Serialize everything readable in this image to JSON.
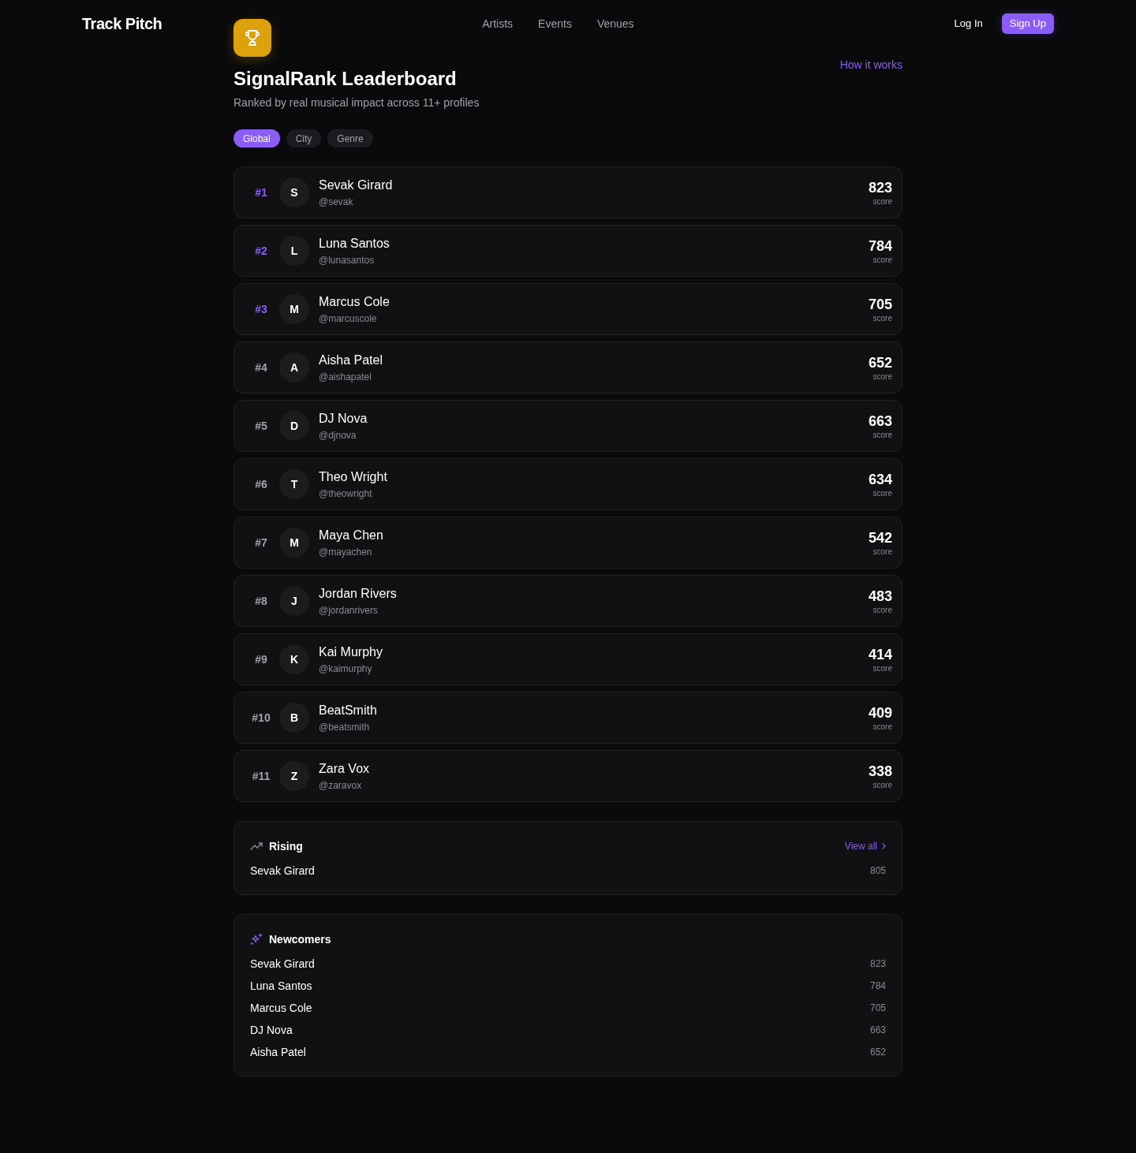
{
  "header": {
    "logo": "Track Pitch",
    "nav": [
      {
        "label": "Artists"
      },
      {
        "label": "Events"
      },
      {
        "label": "Venues"
      }
    ],
    "login": "Log In",
    "signup": "Sign Up"
  },
  "page": {
    "title": "SignalRank Leaderboard",
    "subtitle": "Ranked by real musical impact across 11+ profiles",
    "help_link": "How it works"
  },
  "tabs": [
    {
      "label": "Global",
      "selected": true
    },
    {
      "label": "City",
      "selected": false
    },
    {
      "label": "Genre",
      "selected": false
    }
  ],
  "leaderboard": [
    {
      "rank": "#1",
      "highlighted": true,
      "initial": "S",
      "name": "Sevak Girard",
      "handle": "@sevak",
      "score": "823",
      "score_label": "score"
    },
    {
      "rank": "#2",
      "highlighted": true,
      "initial": "L",
      "name": "Luna Santos",
      "handle": "@lunasantos",
      "score": "784",
      "score_label": "score"
    },
    {
      "rank": "#3",
      "highlighted": true,
      "initial": "M",
      "name": "Marcus Cole",
      "handle": "@marcuscole",
      "score": "705",
      "score_label": "score"
    },
    {
      "rank": "#4",
      "highlighted": false,
      "initial": "A",
      "name": "Aisha Patel",
      "handle": "@aishapatel",
      "score": "652",
      "score_label": "score"
    },
    {
      "rank": "#5",
      "highlighted": false,
      "initial": "D",
      "name": "DJ Nova",
      "handle": "@djnova",
      "score": "663",
      "score_label": "score"
    },
    {
      "rank": "#6",
      "highlighted": false,
      "initial": "T",
      "name": "Theo Wright",
      "handle": "@theowright",
      "score": "634",
      "score_label": "score"
    },
    {
      "rank": "#7",
      "highlighted": false,
      "initial": "M",
      "name": "Maya Chen",
      "handle": "@mayachen",
      "score": "542",
      "score_label": "score"
    },
    {
      "rank": "#8",
      "highlighted": false,
      "initial": "J",
      "name": "Jordan Rivers",
      "handle": "@jordanrivers",
      "score": "483",
      "score_label": "score"
    },
    {
      "rank": "#9",
      "highlighted": false,
      "initial": "K",
      "name": "Kai Murphy",
      "handle": "@kaimurphy",
      "score": "414",
      "score_label": "score"
    },
    {
      "rank": "#10",
      "highlighted": false,
      "initial": "B",
      "name": "BeatSmith",
      "handle": "@beatsmith",
      "score": "409",
      "score_label": "score"
    },
    {
      "rank": "#11",
      "highlighted": false,
      "initial": "Z",
      "name": "Zara Vox",
      "handle": "@zaravox",
      "score": "338",
      "score_label": "score"
    }
  ],
  "rising": {
    "title": "Rising",
    "view_all": "View all",
    "rows": [
      {
        "name": "Sevak Girard",
        "score": "805"
      }
    ]
  },
  "newcomers": {
    "title": "Newcomers",
    "rows": [
      {
        "name": "Sevak Girard",
        "score": "823"
      },
      {
        "name": "Luna Santos",
        "score": "784"
      },
      {
        "name": "Marcus Cole",
        "score": "705"
      },
      {
        "name": "DJ Nova",
        "score": "663"
      },
      {
        "name": "Aisha Patel",
        "score": "652"
      }
    ]
  }
}
